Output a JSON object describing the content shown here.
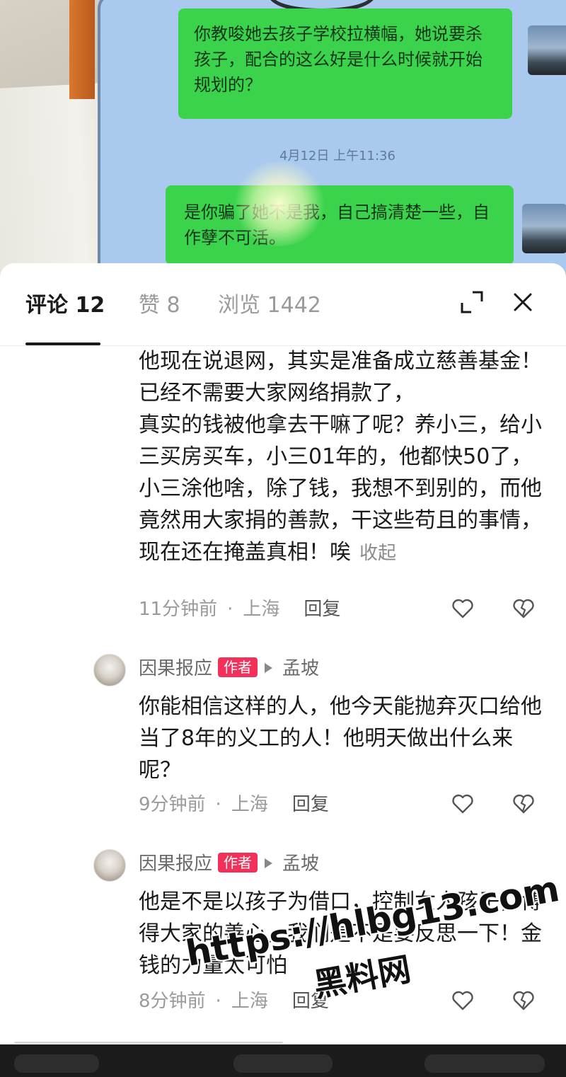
{
  "chat_photo": {
    "message_1": "你教唆她去孩子学校拉横幅，她说要杀孩子，配合的这么好是什么时候就开始规划的？",
    "timestamp": "4月12日 上午11:36",
    "message_2": "是你骗了她不是我，自己搞清楚一些，自作孽不可活。"
  },
  "tabs": {
    "comments": "评论 12",
    "likes": "赞 8",
    "views": "浏览 1442"
  },
  "header_icons": [
    "expand-icon",
    "close-icon"
  ],
  "comments": [
    {
      "text": "他现在说退网，其实是准备成立慈善基金！已经不需要大家网络捐款了，\n真实的钱被他拿去干嘛了呢？养小三，给小三买房买车，小三01年的，他都快50了，小三涂他啥，除了钱，我想不到别的，而他竟然用大家捐的善款，干这些苟且的事情，现在还在掩盖真相！唉",
      "collapse_label": "收起",
      "time": "11分钟前",
      "location": "上海",
      "reply_label": "回复"
    },
    {
      "author": "因果报应",
      "badge": "作者",
      "reply_to": "孟坡",
      "text": "你能相信这样的人，他今天能抛弃灭口给他当了8年的义工的人！他明天做出什么来呢？",
      "time": "9分钟前",
      "location": "上海",
      "reply_label": "回复"
    },
    {
      "author": "因果报应",
      "badge": "作者",
      "reply_to": "孟坡",
      "text": "他是不是以孩子为借口，控制女人孩子，博得大家的善心，我们是不是要反思一下！金钱的力量太可怕",
      "time": "8分钟前",
      "location": "上海",
      "reply_label": "回复"
    }
  ],
  "watermark": {
    "url": "https://hlbg13.com",
    "name": "黑料网"
  },
  "colors": {
    "bubble_green": "#3bd34b",
    "author_badge": "#f2305a",
    "muted_text": "#9a9a9a"
  }
}
